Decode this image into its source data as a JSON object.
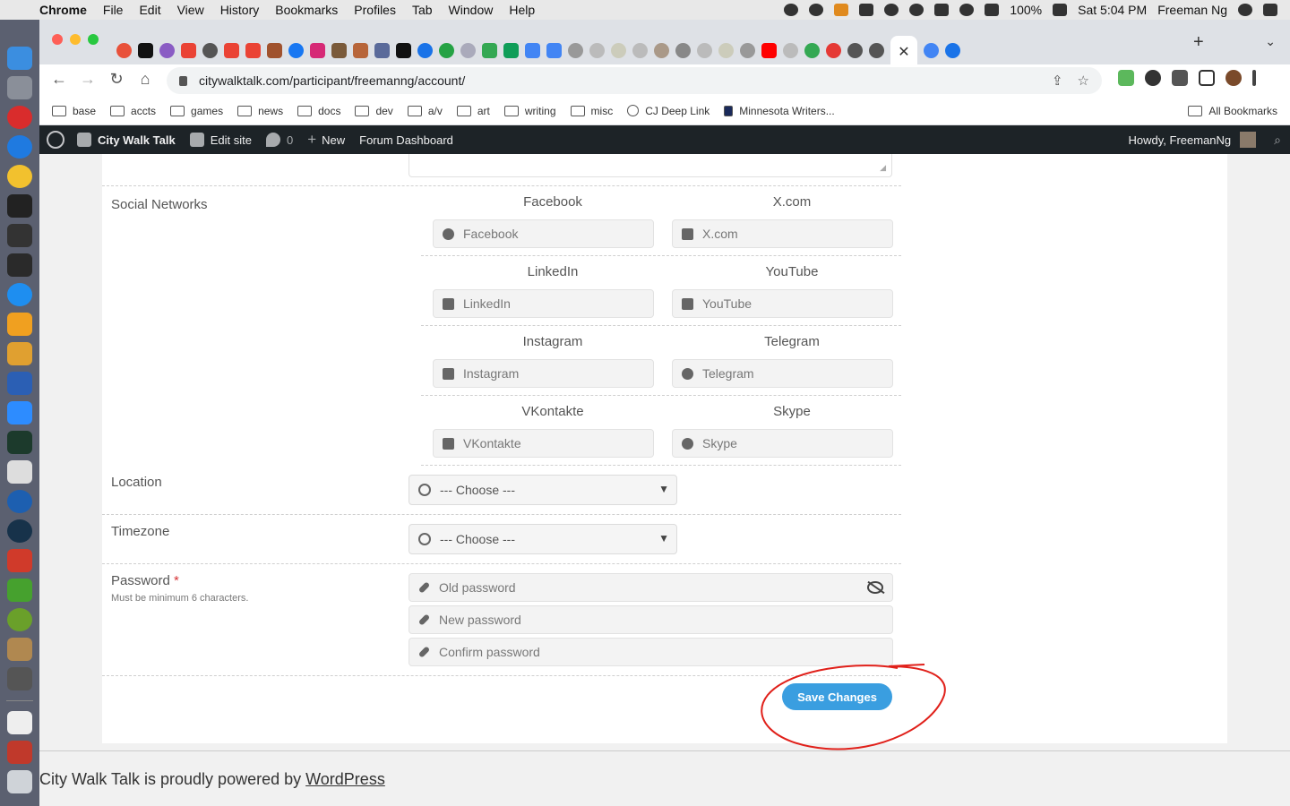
{
  "menubar": {
    "app_name": "Chrome",
    "menus": [
      "File",
      "Edit",
      "View",
      "History",
      "Bookmarks",
      "Profiles",
      "Tab",
      "Window",
      "Help"
    ],
    "battery": "100%",
    "clock": "Sat 5:04 PM",
    "user": "Freeman Ng"
  },
  "browser": {
    "url": "citywalktalk.com/participant/freemanng/account/",
    "active_tab_close": "✕",
    "new_tab": "+",
    "tab_menu": "⌄",
    "bookmarks": [
      "base",
      "accts",
      "games",
      "news",
      "docs",
      "dev",
      "a/v",
      "art",
      "writing",
      "misc"
    ],
    "bookmark_links": [
      "CJ Deep Link",
      "Minnesota Writers..."
    ],
    "all_bookmarks": "All Bookmarks"
  },
  "wpbar": {
    "site_name": "City Walk Talk",
    "edit_site": "Edit site",
    "comments_count": "0",
    "new_label": "New",
    "forum_dashboard": "Forum Dashboard",
    "howdy": "Howdy, FreemanNg"
  },
  "form": {
    "social_label": "Social Networks",
    "social": [
      {
        "title": "Facebook",
        "placeholder": "Facebook"
      },
      {
        "title": "X.com",
        "placeholder": "X.com"
      },
      {
        "title": "LinkedIn",
        "placeholder": "LinkedIn"
      },
      {
        "title": "YouTube",
        "placeholder": "YouTube"
      },
      {
        "title": "Instagram",
        "placeholder": "Instagram"
      },
      {
        "title": "Telegram",
        "placeholder": "Telegram"
      },
      {
        "title": "VKontakte",
        "placeholder": "VKontakte"
      },
      {
        "title": "Skype",
        "placeholder": "Skype"
      }
    ],
    "location_label": "Location",
    "location_value": "--- Choose ---",
    "timezone_label": "Timezone",
    "timezone_value": "--- Choose ---",
    "password_label": "Password",
    "password_required": "*",
    "password_hint": "Must be minimum 6 characters.",
    "old_password": "Old password",
    "new_password": "New password",
    "confirm_password": "Confirm password",
    "save_label": "Save Changes"
  },
  "footer": {
    "text": "City Walk Talk is proudly powered by ",
    "link": "WordPress"
  },
  "colors": {
    "wp_bar": "#1d2327",
    "save_button": "#3a9ee0",
    "annotation": "#e0201a"
  }
}
